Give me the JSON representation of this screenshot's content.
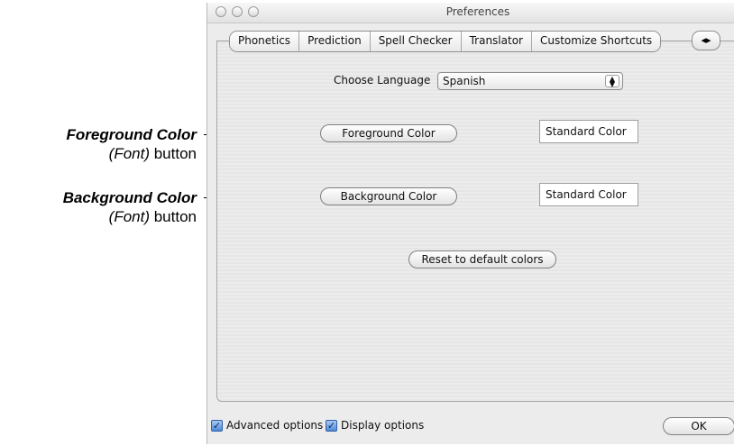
{
  "annotations": {
    "foreground": {
      "title": "Foreground Color",
      "sub_paren": "(Font)",
      "sub_text": " button"
    },
    "background": {
      "title": "Background Color",
      "sub_paren": "(Font)",
      "sub_text": " button"
    }
  },
  "window": {
    "title": "Preferences"
  },
  "tabs": [
    "Phonetics",
    "Prediction",
    "Spell Checker",
    "Translator",
    "Customize Shortcuts"
  ],
  "tab_scroll_icon": "◂▸",
  "language": {
    "label": "Choose Language",
    "value": "Spanish"
  },
  "foreground": {
    "button": "Foreground Color",
    "swatch": "Standard Color",
    "swatch_color": "#ffffff"
  },
  "background": {
    "button": "Background Color",
    "swatch": "Standard Color",
    "swatch_color": "#ffffff"
  },
  "reset_button": "Reset to default colors",
  "footer": {
    "advanced_label": "Advanced options",
    "advanced_checked": true,
    "display_label": "Display options",
    "display_checked": true,
    "ok": "OK"
  }
}
